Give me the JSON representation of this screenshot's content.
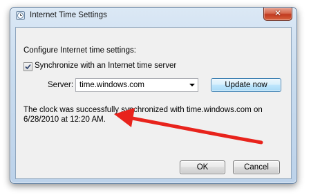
{
  "window": {
    "title": "Internet Time Settings",
    "close_glyph": "✕"
  },
  "content": {
    "heading": "Configure Internet time settings:",
    "sync_checkbox_label": "Synchronize with an Internet time server",
    "sync_checked": true,
    "server_label": "Server:",
    "server_value": "time.windows.com",
    "update_button": "Update now",
    "status_line1": "The clock was successfully synchronized with time.windows.com on",
    "status_line2": "6/28/2010 at 12:20 AM."
  },
  "footer": {
    "ok_button": "OK",
    "cancel_button": "Cancel"
  },
  "annotation": {
    "arrow_color": "#e8231c"
  },
  "icons": {
    "title_icon": "clock-icon",
    "checkmark": "checkmark-icon",
    "dropdown": "chevron-down-icon"
  }
}
